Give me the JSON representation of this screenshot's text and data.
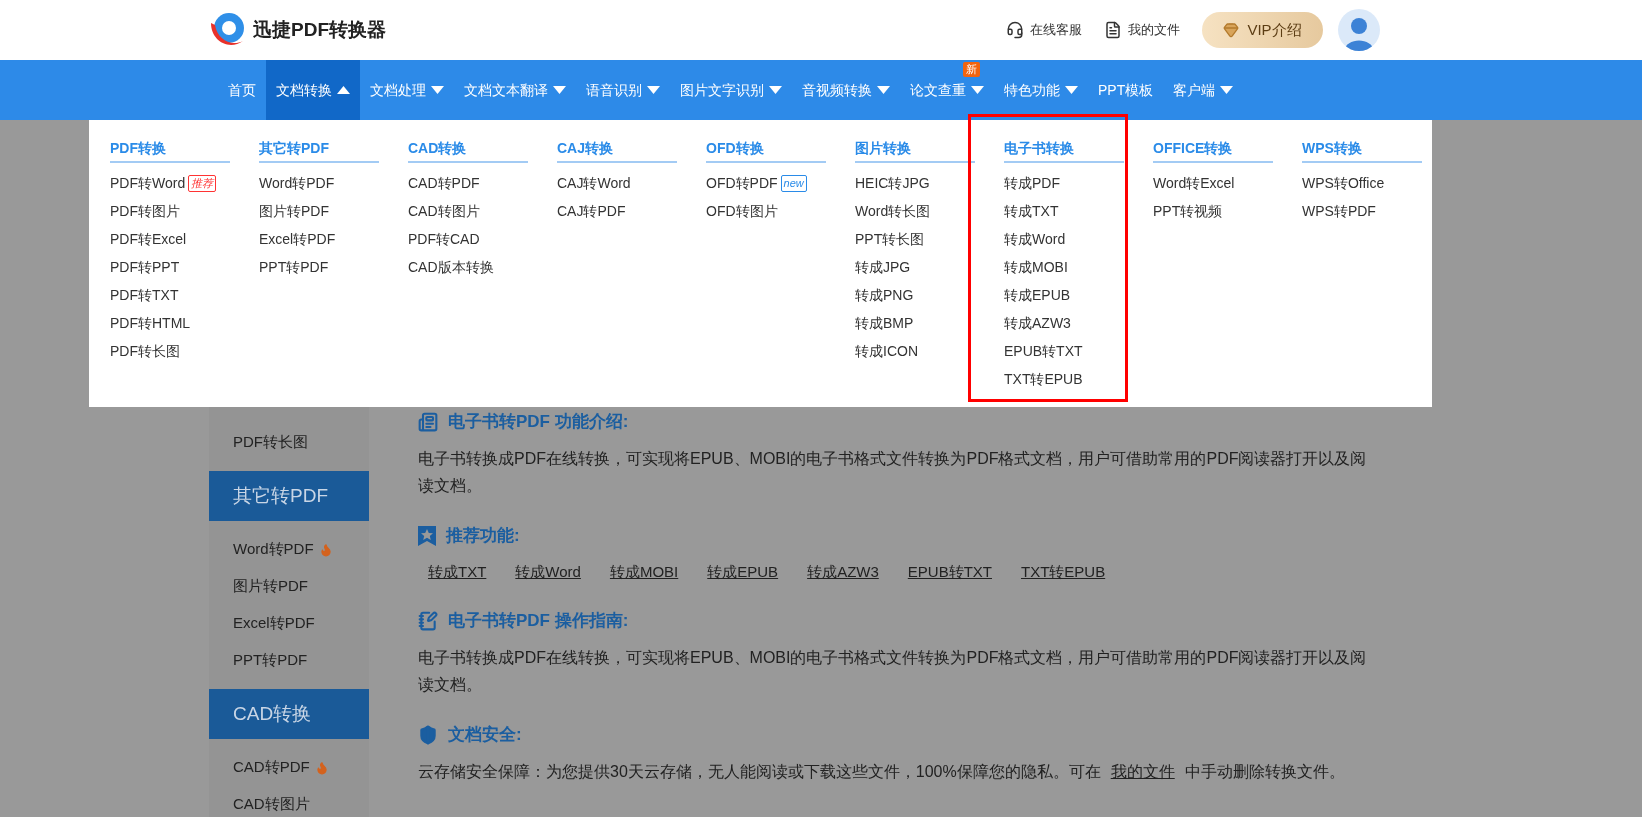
{
  "header": {
    "logo_text": "迅捷PDF转换器",
    "links": [
      {
        "kind": "service",
        "label": "在线客服"
      },
      {
        "kind": "files",
        "label": "我的文件"
      }
    ],
    "vip_button": "VIP介绍"
  },
  "nav": [
    {
      "label": "首页",
      "caret": false,
      "selected": false
    },
    {
      "label": "文档转换",
      "caret": true,
      "selected": true
    },
    {
      "label": "文档处理",
      "caret": true,
      "selected": false
    },
    {
      "label": "文档文本翻译",
      "caret": true,
      "selected": false
    },
    {
      "label": "语音识别",
      "caret": true,
      "selected": false
    },
    {
      "label": "图片文字识别",
      "caret": true,
      "selected": false
    },
    {
      "label": "音视频转换",
      "caret": true,
      "selected": false
    },
    {
      "label": "论文查重",
      "caret": true,
      "selected": false,
      "badge": "新"
    },
    {
      "label": "特色功能",
      "caret": true,
      "selected": false
    },
    {
      "label": "PPT模板",
      "caret": false,
      "selected": false
    },
    {
      "label": "客户端",
      "caret": true,
      "selected": false
    }
  ],
  "dropdown": {
    "columns": [
      {
        "title": "PDF转换",
        "highlighted": false,
        "items": [
          {
            "label": "PDF转Word",
            "tag": {
              "kind": "recommend",
              "text": "推荐"
            }
          },
          {
            "label": "PDF转图片"
          },
          {
            "label": "PDF转Excel"
          },
          {
            "label": "PDF转PPT"
          },
          {
            "label": "PDF转TXT"
          },
          {
            "label": "PDF转HTML"
          },
          {
            "label": "PDF转长图"
          }
        ]
      },
      {
        "title": "其它转PDF",
        "highlighted": false,
        "items": [
          {
            "label": "Word转PDF"
          },
          {
            "label": "图片转PDF"
          },
          {
            "label": "Excel转PDF"
          },
          {
            "label": "PPT转PDF"
          }
        ]
      },
      {
        "title": "CAD转换",
        "highlighted": false,
        "items": [
          {
            "label": "CAD转PDF"
          },
          {
            "label": "CAD转图片"
          },
          {
            "label": "PDF转CAD"
          },
          {
            "label": "CAD版本转换"
          }
        ]
      },
      {
        "title": "CAJ转换",
        "highlighted": false,
        "items": [
          {
            "label": "CAJ转Word"
          },
          {
            "label": "CAJ转PDF"
          }
        ]
      },
      {
        "title": "OFD转换",
        "highlighted": false,
        "items": [
          {
            "label": "OFD转PDF",
            "tag": {
              "kind": "new",
              "text": "new"
            }
          },
          {
            "label": "OFD转图片"
          }
        ]
      },
      {
        "title": "图片转换",
        "highlighted": false,
        "items": [
          {
            "label": "HEIC转JPG"
          },
          {
            "label": "Word转长图"
          },
          {
            "label": "PPT转长图"
          },
          {
            "label": "转成JPG"
          },
          {
            "label": "转成PNG"
          },
          {
            "label": "转成BMP"
          },
          {
            "label": "转成ICON"
          }
        ]
      },
      {
        "title": "电子书转换",
        "highlighted": true,
        "items": [
          {
            "label": "转成PDF"
          },
          {
            "label": "转成TXT"
          },
          {
            "label": "转成Word"
          },
          {
            "label": "转成MOBI"
          },
          {
            "label": "转成EPUB"
          },
          {
            "label": "转成AZW3"
          },
          {
            "label": "EPUB转TXT"
          },
          {
            "label": "TXT转EPUB"
          }
        ]
      },
      {
        "title": "OFFICE转换",
        "highlighted": false,
        "items": [
          {
            "label": "Word转Excel"
          },
          {
            "label": "PPT转视频"
          }
        ]
      },
      {
        "title": "WPS转换",
        "highlighted": false,
        "items": [
          {
            "label": "WPS转Office"
          },
          {
            "label": "WPS转PDF"
          }
        ]
      }
    ]
  },
  "sidebar": [
    {
      "kind": "link",
      "label": "PDF转长图",
      "hot": false
    },
    {
      "kind": "heading",
      "label": "其它转PDF"
    },
    {
      "kind": "link",
      "label": "Word转PDF",
      "hot": true
    },
    {
      "kind": "link",
      "label": "图片转PDF",
      "hot": false
    },
    {
      "kind": "link",
      "label": "Excel转PDF",
      "hot": false
    },
    {
      "kind": "link",
      "label": "PPT转PDF",
      "hot": false
    },
    {
      "kind": "heading",
      "label": "CAD转换"
    },
    {
      "kind": "link",
      "label": "CAD转PDF",
      "hot": true
    },
    {
      "kind": "link",
      "label": "CAD转图片",
      "hot": false
    }
  ],
  "sections": [
    {
      "kind": "intro",
      "title": "电子书转PDF 功能介绍:",
      "paragraph": "电子书转换成PDF在线转换，可实现将EPUB、MOBI的电子书格式文件转换为PDF格式文档，用户可借助常用的PDF阅读器打开以及阅读文档。"
    },
    {
      "kind": "recommend",
      "title": "推荐功能:",
      "links": [
        "转成TXT",
        "转成Word",
        "转成MOBI",
        "转成EPUB",
        "转成AZW3",
        "EPUB转TXT",
        "TXT转EPUB"
      ]
    },
    {
      "kind": "guide",
      "title": "电子书转PDF 操作指南:",
      "paragraph": "电子书转换成PDF在线转换，可实现将EPUB、MOBI的电子书格式文件转换为PDF格式文档，用户可借助常用的PDF阅读器打开以及阅读文档。"
    },
    {
      "kind": "security",
      "title": "文档安全:",
      "paragraph": "云存储安全保障：为您提供30天云存储，无人能阅读或下载这些文件，100%保障您的隐私。可在",
      "link": "我的文件",
      "after": "中手动删除转换文件。"
    }
  ]
}
